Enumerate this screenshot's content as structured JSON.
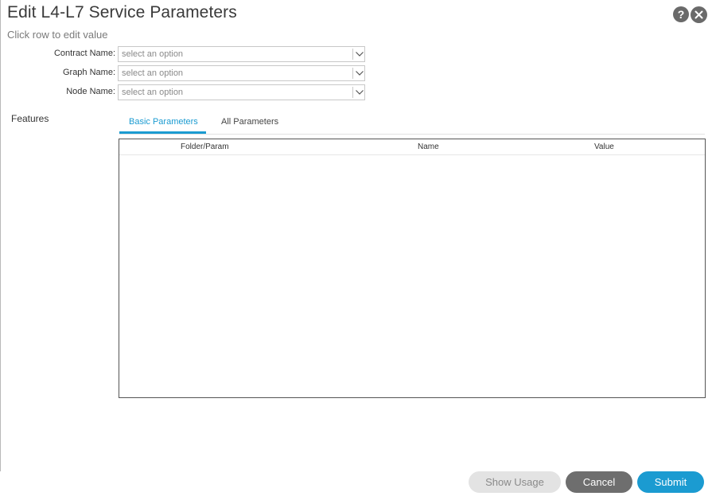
{
  "dialog": {
    "title": "Edit L4-L7 Service Parameters",
    "subtitle": "Click row to edit value",
    "help_icon": "question-icon",
    "help_glyph": "?",
    "close_icon": "close-icon"
  },
  "form": {
    "contract": {
      "label": "Contract Name:",
      "placeholder": "select an option"
    },
    "graph": {
      "label": "Graph Name:",
      "placeholder": "select an option"
    },
    "node": {
      "label": "Node Name:",
      "placeholder": "select an option"
    }
  },
  "features": {
    "label": "Features",
    "tabs": [
      {
        "label": "Basic Parameters",
        "active": true
      },
      {
        "label": "All Parameters",
        "active": false
      }
    ],
    "columns": [
      "Folder/Param",
      "Name",
      "Value"
    ],
    "rows": []
  },
  "footer": {
    "show_usage": "Show Usage",
    "cancel": "Cancel",
    "submit": "Submit"
  },
  "colors": {
    "accent": "#1b9bd1",
    "button_gray": "#6e6e6e",
    "disabled_bg": "#e3e3e3"
  }
}
